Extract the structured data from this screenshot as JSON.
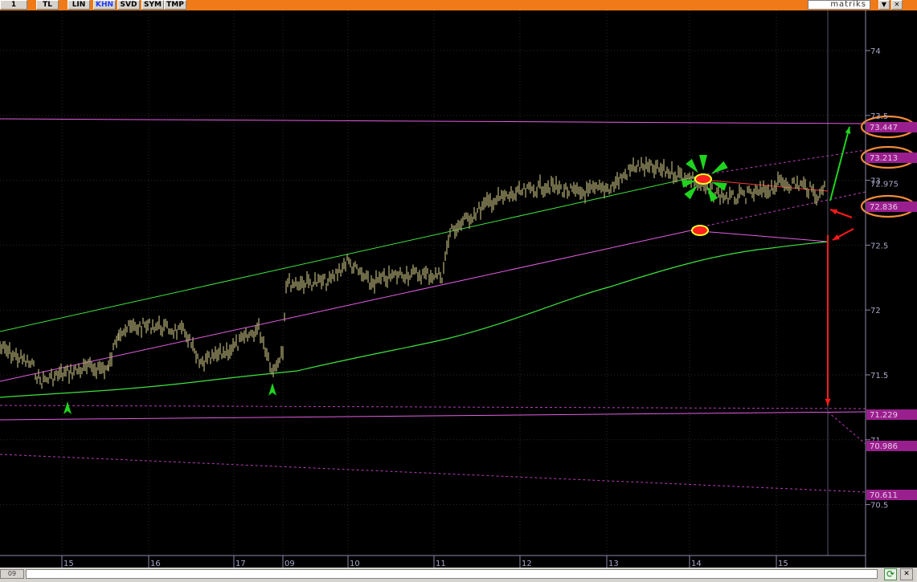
{
  "toolbar": {
    "buttons": [
      {
        "label": "1",
        "active": false
      },
      {
        "label": "TL",
        "active": false
      },
      {
        "label": "LIN",
        "active": false
      },
      {
        "label": "KHN",
        "active": true
      },
      {
        "label": "SVD",
        "active": false
      },
      {
        "label": "SYM",
        "active": false
      },
      {
        "label": "TMP",
        "active": false
      }
    ],
    "brand": "matriks",
    "menu_glyph": "▼",
    "close_glyph": "✕"
  },
  "statusbar": {
    "left_text": "09",
    "refresh_glyph": "⟳",
    "close_glyph": "✕"
  },
  "colors": {
    "background": "#000000",
    "price": "#a9a36e",
    "channel_green": "#3fe23f",
    "channel_magenta": "#e35ee3",
    "dashed_magenta": "#b93cb9",
    "arrow_green": "#1fd31f",
    "arrow_red": "#ff1a1a",
    "label_bg": "#9a1f8e",
    "highlight_ring": "#f28b3a",
    "axis_text": "#a8a8c8",
    "grid": "#2a2a2a"
  },
  "chart_data": {
    "type": "line",
    "x_tick_labels": [
      "15",
      "16",
      "17",
      "09",
      "10",
      "11",
      "12",
      "13",
      "14",
      "15"
    ],
    "y_ticks": [
      "74",
      "73.5",
      "73",
      "72.5",
      "72",
      "71.5",
      "71",
      "70.5"
    ],
    "last_price": "72.975",
    "level_labels": [
      "73.447",
      "73.213",
      "72.836",
      "71.229",
      "70.986",
      "70.611"
    ],
    "highlighted_levels": [
      "73.447",
      "73.213",
      "72.836"
    ],
    "ylim": [
      70.1,
      74.3
    ],
    "grid": true
  }
}
